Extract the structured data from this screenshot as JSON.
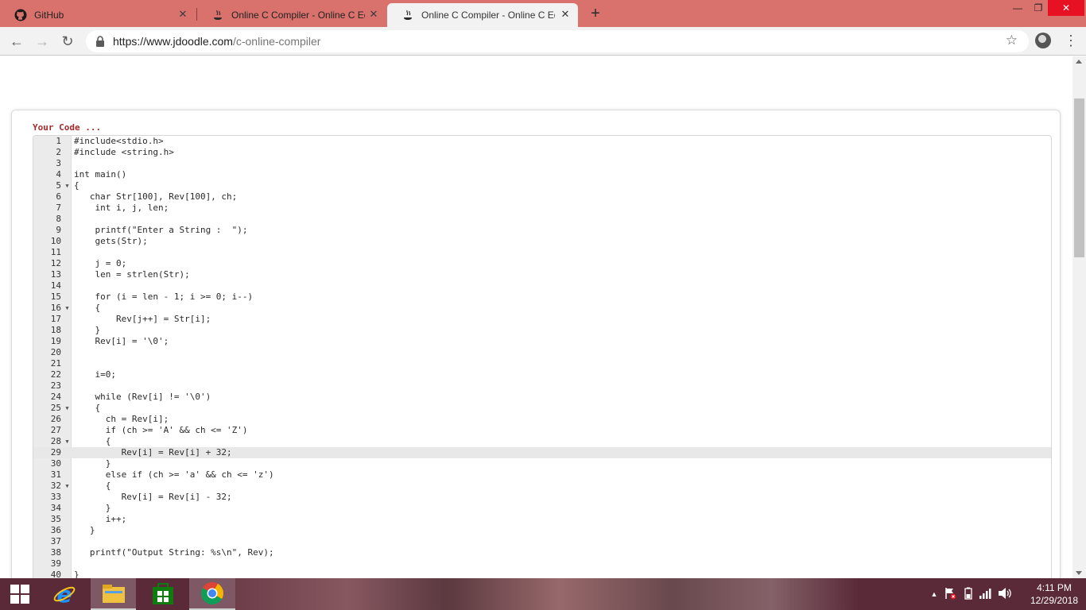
{
  "browser": {
    "tabs": [
      {
        "title": "GitHub",
        "state": "inactive",
        "icon": "github-icon"
      },
      {
        "title": "Online C Compiler - Online C Edi",
        "state": "inactive",
        "icon": "jdoodle-icon"
      },
      {
        "title": "Online C Compiler - Online C Edi",
        "state": "active",
        "icon": "jdoodle-icon"
      }
    ],
    "url_host": "https://www.jdoodle.com",
    "url_path": "/c-online-compiler",
    "colors": {
      "tabstrip": "#d9716c",
      "close": "#e81123"
    }
  },
  "editor": {
    "title": "Your Code ...",
    "active_line": 29,
    "lines": [
      {
        "n": "1",
        "fold": "",
        "text": "#include<stdio.h>"
      },
      {
        "n": "2",
        "fold": "",
        "text": "#include <string.h>"
      },
      {
        "n": "3",
        "fold": "",
        "text": ""
      },
      {
        "n": "4",
        "fold": "",
        "text": "int main()"
      },
      {
        "n": "5",
        "fold": "▼",
        "text": "{"
      },
      {
        "n": "6",
        "fold": "",
        "text": "   char Str[100], Rev[100], ch;"
      },
      {
        "n": "7",
        "fold": "",
        "text": "    int i, j, len;"
      },
      {
        "n": "8",
        "fold": "",
        "text": ""
      },
      {
        "n": "9",
        "fold": "",
        "text": "    printf(\"Enter a String :  \");"
      },
      {
        "n": "10",
        "fold": "",
        "text": "    gets(Str);"
      },
      {
        "n": "11",
        "fold": "",
        "text": ""
      },
      {
        "n": "12",
        "fold": "",
        "text": "    j = 0;"
      },
      {
        "n": "13",
        "fold": "",
        "text": "    len = strlen(Str);"
      },
      {
        "n": "14",
        "fold": "",
        "text": ""
      },
      {
        "n": "15",
        "fold": "",
        "text": "    for (i = len - 1; i >= 0; i--)"
      },
      {
        "n": "16",
        "fold": "▼",
        "text": "    {"
      },
      {
        "n": "17",
        "fold": "",
        "text": "        Rev[j++] = Str[i];"
      },
      {
        "n": "18",
        "fold": "",
        "text": "    }"
      },
      {
        "n": "19",
        "fold": "",
        "text": "    Rev[i] = '\\0';"
      },
      {
        "n": "20",
        "fold": "",
        "text": ""
      },
      {
        "n": "21",
        "fold": "",
        "text": ""
      },
      {
        "n": "22",
        "fold": "",
        "text": "    i=0;"
      },
      {
        "n": "23",
        "fold": "",
        "text": ""
      },
      {
        "n": "24",
        "fold": "",
        "text": "    while (Rev[i] != '\\0')"
      },
      {
        "n": "25",
        "fold": "▼",
        "text": "    {"
      },
      {
        "n": "26",
        "fold": "",
        "text": "      ch = Rev[i];"
      },
      {
        "n": "27",
        "fold": "",
        "text": "      if (ch >= 'A' && ch <= 'Z')"
      },
      {
        "n": "28",
        "fold": "▼",
        "text": "      {"
      },
      {
        "n": "29",
        "fold": "",
        "text": "         Rev[i] = Rev[i] + 32;"
      },
      {
        "n": "30",
        "fold": "",
        "text": "      }"
      },
      {
        "n": "31",
        "fold": "",
        "text": "      else if (ch >= 'a' && ch <= 'z')"
      },
      {
        "n": "32",
        "fold": "▼",
        "text": "      {"
      },
      {
        "n": "33",
        "fold": "",
        "text": "         Rev[i] = Rev[i] - 32;"
      },
      {
        "n": "34",
        "fold": "",
        "text": "      }"
      },
      {
        "n": "35",
        "fold": "",
        "text": "      i++;"
      },
      {
        "n": "36",
        "fold": "",
        "text": "   }"
      },
      {
        "n": "37",
        "fold": "",
        "text": ""
      },
      {
        "n": "38",
        "fold": "",
        "text": "   printf(\"Output String: %s\\n\", Rev);"
      },
      {
        "n": "39",
        "fold": "",
        "text": ""
      },
      {
        "n": "40",
        "fold": "",
        "text": "}"
      }
    ]
  },
  "taskbar": {
    "time": "4:11 PM",
    "date": "12/29/2018",
    "pinned": [
      "windows-start-icon",
      "internet-explorer-icon",
      "file-explorer-icon",
      "store-icon",
      "chrome-icon"
    ]
  }
}
